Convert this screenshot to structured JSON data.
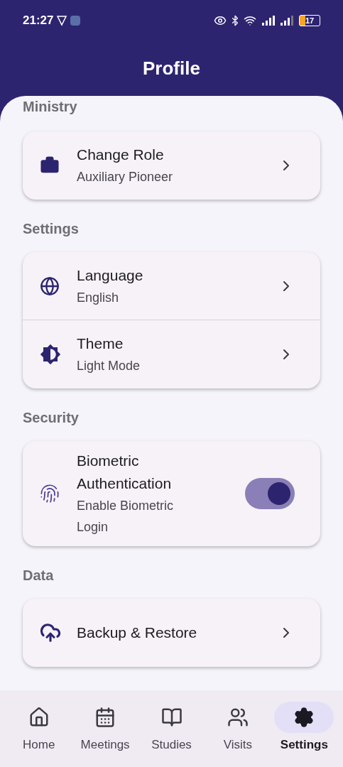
{
  "status_bar": {
    "time": "21:27",
    "battery": "17"
  },
  "header": {
    "title": "Profile"
  },
  "sections": [
    {
      "title": "Ministry",
      "items": [
        {
          "kind": "link",
          "title": "Change Role",
          "subtitle": "Auxiliary Pioneer"
        }
      ]
    },
    {
      "title": "Settings",
      "items": [
        {
          "kind": "link",
          "title": "Language",
          "subtitle": "English"
        },
        {
          "kind": "link",
          "title": "Theme",
          "subtitle": "Light Mode"
        }
      ]
    },
    {
      "title": "Security",
      "items": [
        {
          "kind": "toggle",
          "title": "Biometric Authentication",
          "subtitle": "Enable Biometric Login",
          "on": true
        }
      ]
    },
    {
      "title": "Data",
      "items": [
        {
          "kind": "link",
          "title": "Backup & Restore"
        }
      ]
    }
  ],
  "nav": [
    {
      "label": "Home",
      "selected": false
    },
    {
      "label": "Meetings",
      "selected": false
    },
    {
      "label": "Studies",
      "selected": false
    },
    {
      "label": "Visits",
      "selected": false
    },
    {
      "label": "Settings",
      "selected": true
    }
  ]
}
